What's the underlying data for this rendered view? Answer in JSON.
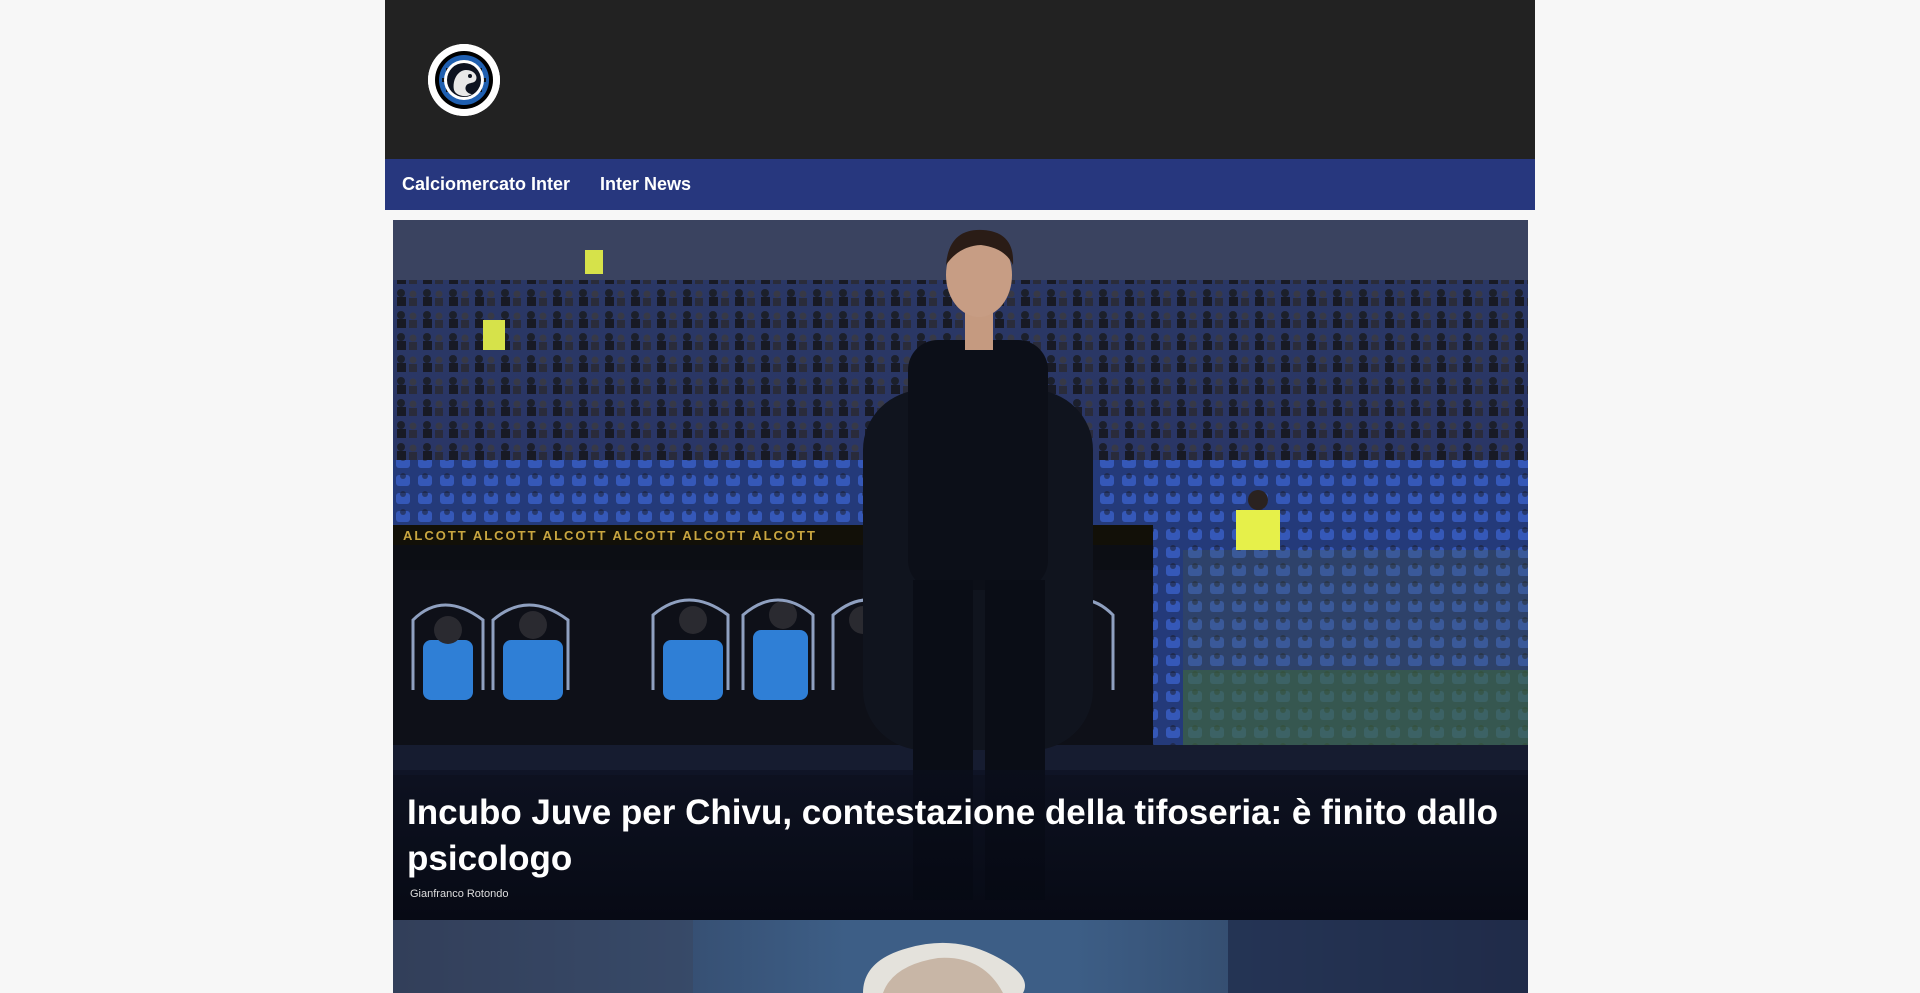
{
  "header": {
    "logo_icon": "inter-biscione-logo-icon",
    "background": "#222222"
  },
  "nav": {
    "background": "#27377e",
    "items": [
      {
        "label": "Calciomercato Inter"
      },
      {
        "label": "Inter News"
      }
    ]
  },
  "articles": [
    {
      "title": "Incubo Juve per Chivu, contestazione della tifoseria: è finito dallo psicologo",
      "author": "Gianfranco Rotondo",
      "image": "coach-standing-in-stadium-photo"
    },
    {
      "title": "",
      "author": "",
      "image": "white-haired-man-photo"
    }
  ]
}
